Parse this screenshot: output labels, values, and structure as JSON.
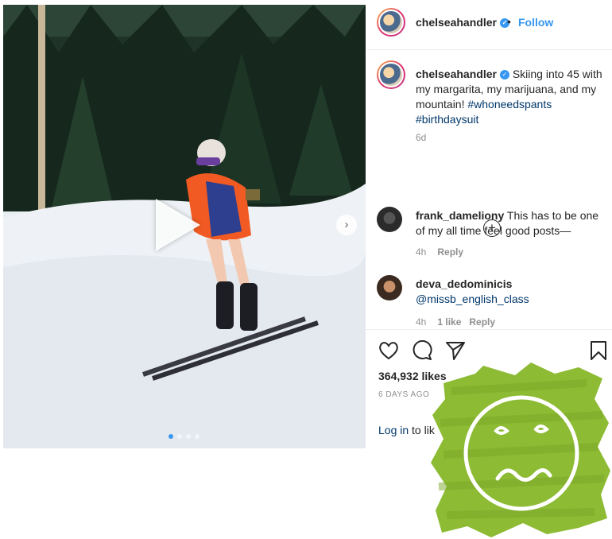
{
  "post": {
    "username": "chelseahandler",
    "follow_label": "Follow",
    "dot": "•",
    "caption_text": "Skiing into 45 with my margarita, my marijuana, and my mountain!",
    "hashtag1": "#whoneedspants",
    "hashtag2": "#birthdaysuit",
    "caption_time": "6d",
    "more_comments_icon": "plus-circle-icon"
  },
  "comments": [
    {
      "username": "frank_dameliony",
      "text": "This has to be one of my all time feel good posts—",
      "time": "4h",
      "reply": "Reply"
    },
    {
      "username": "deva_dedominicis",
      "text": "@missb_english_class",
      "time": "4h",
      "likes": "1 like",
      "reply": "Reply"
    }
  ],
  "actions": {
    "like_icon": "heart-icon",
    "comment_icon": "comment-icon",
    "share_icon": "send-icon",
    "save_icon": "bookmark-icon",
    "likes_count": "364,932 likes",
    "date": "6 DAYS AGO",
    "login_link": "Log in",
    "login_rest": "to lik"
  },
  "media": {
    "carousel_total": 4,
    "carousel_active": 1,
    "next_icon": "chevron-right-icon",
    "play_icon": "play-icon"
  },
  "sticker": {
    "icon": "sad-face-icon",
    "color": "#8dbb34"
  },
  "colors": {
    "link": "#3897f0",
    "hashtag": "#00376b",
    "meta": "#8e8e8e"
  }
}
